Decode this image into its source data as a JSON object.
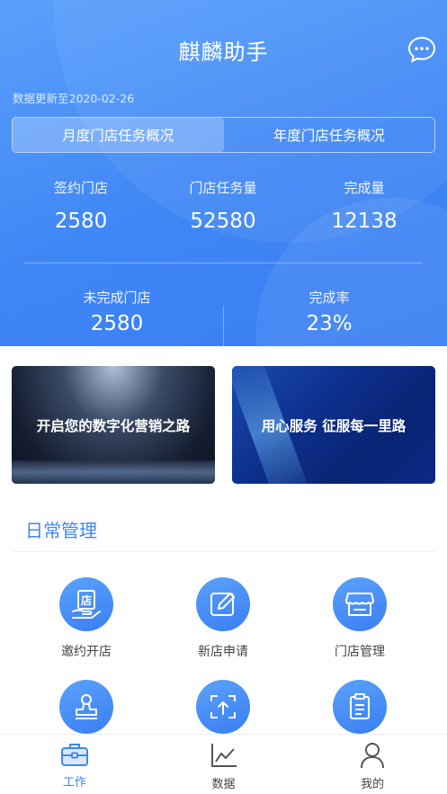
{
  "header": {
    "title": "麒麟助手",
    "update_text": "数据更新至2020-02-26",
    "tabs": [
      {
        "label": "月度门店任务概况",
        "active": true
      },
      {
        "label": "年度门店任务概况",
        "active": false
      }
    ],
    "stats": [
      {
        "label": "签约门店",
        "value": "2580"
      },
      {
        "label": "门店任务量",
        "value": "52580"
      },
      {
        "label": "完成量",
        "value": "12138"
      },
      {
        "label": "未完成门店",
        "value": "2580"
      },
      {
        "label": "完成率",
        "value": "23%"
      }
    ]
  },
  "banners": [
    {
      "text": "开启您的数字化营销之路"
    },
    {
      "text": "用心服务  征服每一里路"
    }
  ],
  "daily": {
    "title": "日常管理",
    "items": [
      {
        "label": "邀约开店",
        "icon": "store-hand-icon"
      },
      {
        "label": "新店申请",
        "icon": "edit-icon"
      },
      {
        "label": "门店管理",
        "icon": "shop-icon"
      },
      {
        "label": "",
        "icon": "stamp-icon"
      },
      {
        "label": "",
        "icon": "scan-upload-icon"
      },
      {
        "label": "",
        "icon": "clipboard-icon"
      }
    ]
  },
  "tabbar": {
    "items": [
      {
        "label": "工作",
        "icon": "briefcase-icon",
        "active": true
      },
      {
        "label": "数据",
        "icon": "line-chart-icon",
        "active": false
      },
      {
        "label": "我的",
        "icon": "user-icon",
        "active": false
      }
    ]
  },
  "colors": {
    "primary": "#3f86f5",
    "header_light": "#5aa0fb"
  }
}
